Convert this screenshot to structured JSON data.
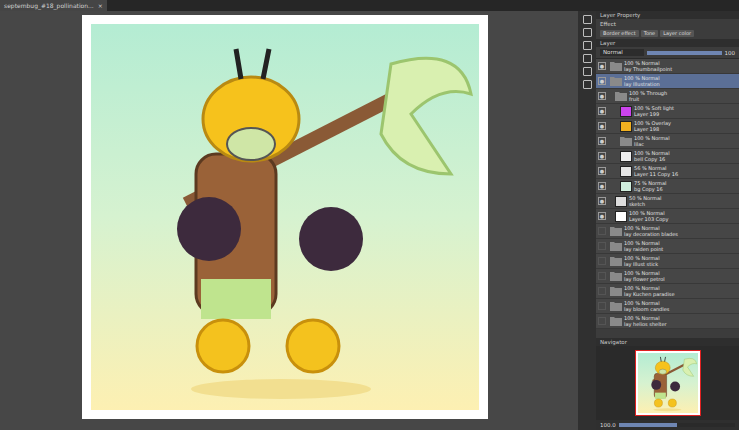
{
  "window": {
    "tab": "septembug_#18_pollination...",
    "close": "×"
  },
  "properties_panel": {
    "title": "Layer Property",
    "effect_label": "Effect",
    "buttons": [
      "Border effect",
      "Tone",
      "Layer color"
    ]
  },
  "layer_panel": {
    "title": "Layer",
    "blend_mode": "Normal",
    "opacity": "100",
    "opacity_level": 1.0,
    "layers": [
      {
        "mode": "100 % Normal",
        "name": "lay Thumbnailpoint",
        "kind": "folder",
        "selected": false,
        "visible": true,
        "indent": 0,
        "color": "#8a8a8a"
      },
      {
        "mode": "100 % Normal",
        "name": "lay Illustration",
        "kind": "folder",
        "selected": true,
        "visible": true,
        "indent": 0,
        "color": "#8a8a8a"
      },
      {
        "mode": "100 % Through",
        "name": "fruit",
        "kind": "folder",
        "selected": false,
        "visible": true,
        "indent": 1,
        "color": "#8a8a8a"
      },
      {
        "mode": "100 % Soft light",
        "name": "Layer 199",
        "kind": "raster",
        "selected": false,
        "visible": true,
        "indent": 2,
        "color": "#cc44ee"
      },
      {
        "mode": "100 % Overlay",
        "name": "Layer 198",
        "kind": "raster",
        "selected": false,
        "visible": true,
        "indent": 2,
        "color": "#f0b020"
      },
      {
        "mode": "100 % Normal",
        "name": "lilac",
        "kind": "folder",
        "selected": false,
        "visible": true,
        "indent": 2,
        "color": "#8a8a8a"
      },
      {
        "mode": "100 % Normal",
        "name": "bell Copy 16",
        "kind": "raster",
        "selected": false,
        "visible": true,
        "indent": 2,
        "color": "#eeeeee"
      },
      {
        "mode": "56 % Normal",
        "name": "Layer 11 Copy 16",
        "kind": "raster",
        "selected": false,
        "visible": true,
        "indent": 2,
        "color": "#e6e6e6"
      },
      {
        "mode": "75 % Normal",
        "name": "bg Copy 16",
        "kind": "raster",
        "selected": false,
        "visible": true,
        "indent": 2,
        "color": "#cfeedd"
      },
      {
        "mode": "50 % Normal",
        "name": "sketch",
        "kind": "raster",
        "selected": false,
        "visible": true,
        "indent": 1,
        "color": "#dddddd"
      },
      {
        "mode": "100 % Normal",
        "name": "Layer 103 Copy",
        "kind": "raster",
        "selected": false,
        "visible": true,
        "indent": 1,
        "color": "#ffffff"
      },
      {
        "mode": "100 % Normal",
        "name": "lay decoration blades",
        "kind": "folder",
        "selected": false,
        "visible": false,
        "indent": 0,
        "color": "#8a8a8a"
      },
      {
        "mode": "100 % Normal",
        "name": "lay raiden point",
        "kind": "folder",
        "selected": false,
        "visible": false,
        "indent": 0,
        "color": "#8a8a8a"
      },
      {
        "mode": "100 % Normal",
        "name": "lay Illust stick",
        "kind": "folder",
        "selected": false,
        "visible": false,
        "indent": 0,
        "color": "#8a8a8a"
      },
      {
        "mode": "100 % Normal",
        "name": "lay flower petrol",
        "kind": "folder",
        "selected": false,
        "visible": false,
        "indent": 0,
        "color": "#8a8a8a"
      },
      {
        "mode": "100 % Normal",
        "name": "lay Kuchen paradise",
        "kind": "folder",
        "selected": false,
        "visible": false,
        "indent": 0,
        "color": "#8a8a8a"
      },
      {
        "mode": "100 % Normal",
        "name": "lay bloom candles",
        "kind": "folder",
        "selected": false,
        "visible": false,
        "indent": 0,
        "color": "#8a8a8a"
      },
      {
        "mode": "100 % Normal",
        "name": "lay helios shelter",
        "kind": "folder",
        "selected": false,
        "visible": false,
        "indent": 0,
        "color": "#8a8a8a"
      }
    ]
  },
  "navigator": {
    "title": "Navigator",
    "zoom": "100.0",
    "zoom_level": 0.5
  }
}
